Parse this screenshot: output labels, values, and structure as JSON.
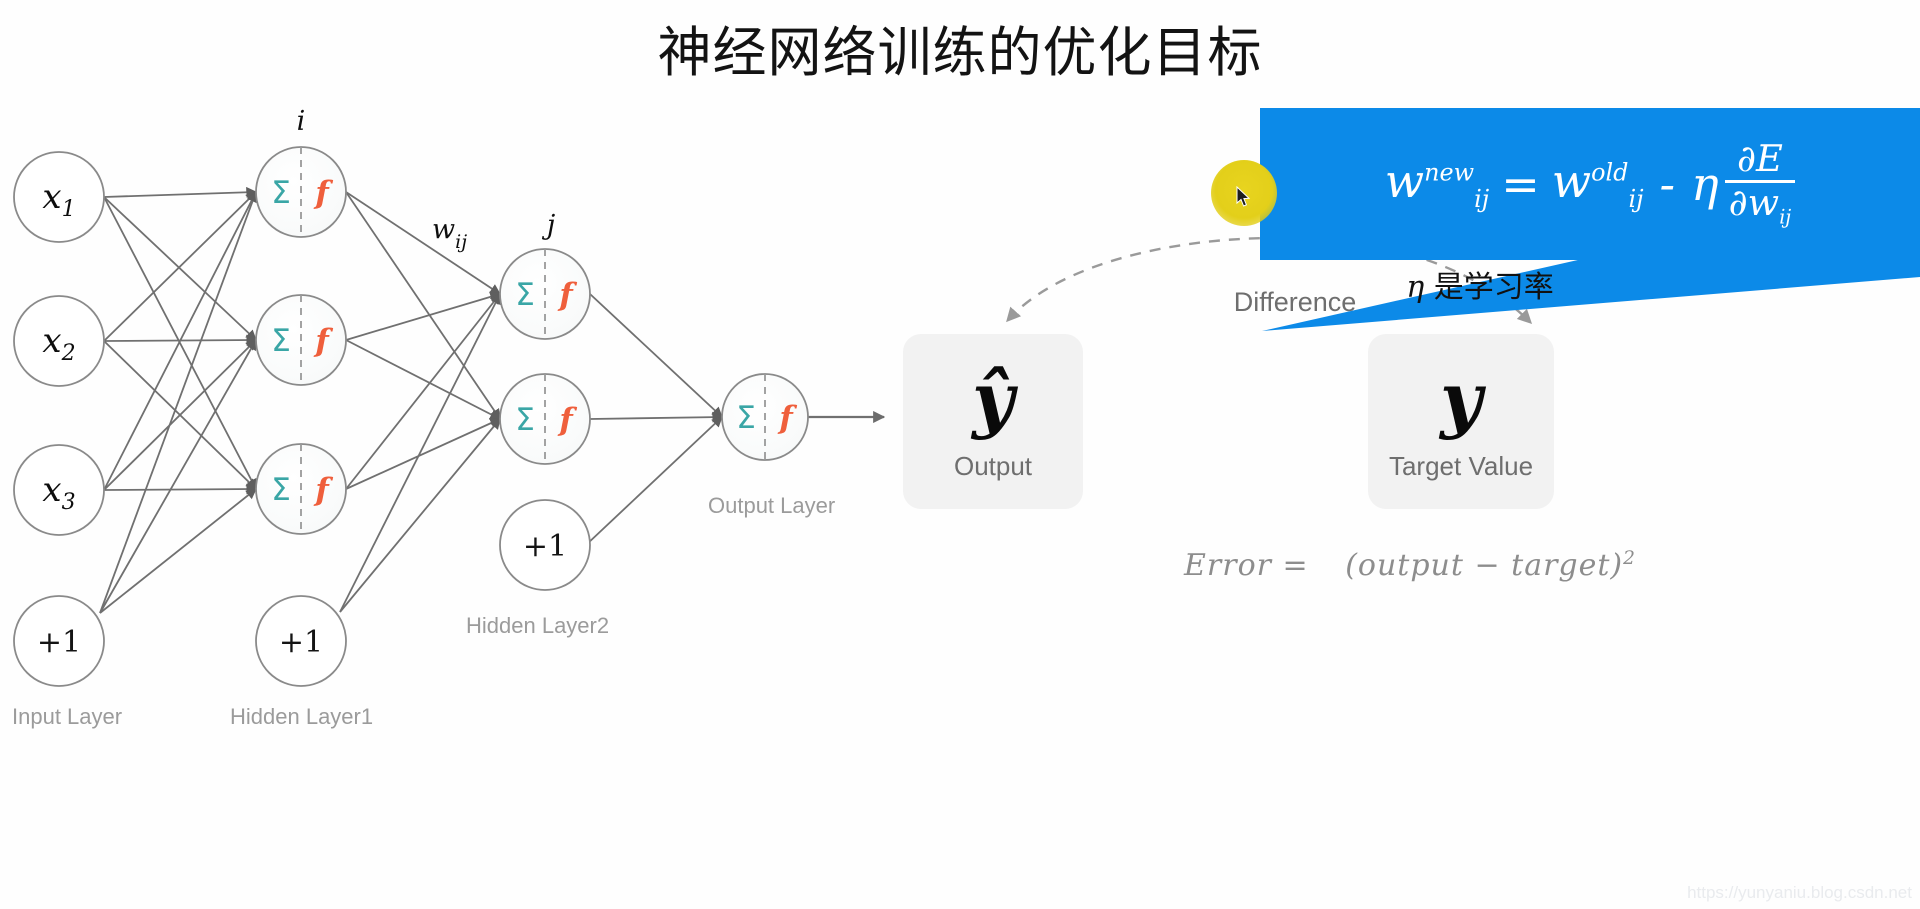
{
  "page_title": "神经网络训练的优化目标",
  "formula_callout": {
    "w": "w",
    "eq": "=",
    "minus": "-",
    "eta": "η",
    "sup_new": "new",
    "sup_old": "old",
    "sub_ij": "ij",
    "numerator": "∂E",
    "denominator_partial": "∂w",
    "denominator_sub": "ij",
    "background_color": "#0c8ae8",
    "text_color": "#ffffff"
  },
  "eta_note": {
    "symbol": "η",
    "text": " 是学习率"
  },
  "difference_label": "Difference",
  "output_box": {
    "glyph": "ŷ",
    "caption": "Output"
  },
  "target_box": {
    "glyph": "y",
    "caption": "Target Value"
  },
  "error_formula": {
    "lhs": "Error = ",
    "rhs": "(output − target)",
    "exponent": "2"
  },
  "network": {
    "input_nodes": [
      "x₁",
      "x₂",
      "x₃",
      "+1"
    ],
    "hidden1_nodes": [
      "Σ f",
      "Σ f",
      "Σ f",
      "+1"
    ],
    "hidden2_nodes": [
      "Σ f",
      "Σ f",
      "+1"
    ],
    "output_nodes": [
      "Σ f"
    ],
    "neuron_sum_symbol": "Σ",
    "neuron_activation_symbol": "f",
    "bias_label": "+1",
    "index_label_i": "i",
    "index_label_j": "j",
    "weight_label": "w",
    "weight_label_sub": "ij",
    "input_labels": [
      "x",
      "x",
      "x"
    ],
    "input_subs": [
      "1",
      "2",
      "3"
    ],
    "captions": {
      "input": "Input Layer",
      "hidden1": "Hidden Layer1",
      "hidden2": "Hidden Layer2",
      "output": "Output Layer"
    },
    "colors": {
      "sum": "#3aa6a6",
      "activation": "#ef5f3c",
      "edge": "#707070",
      "node_stroke": "#8a8a8a"
    }
  },
  "watermark": "https://yunyaniu.blog.csdn.net"
}
